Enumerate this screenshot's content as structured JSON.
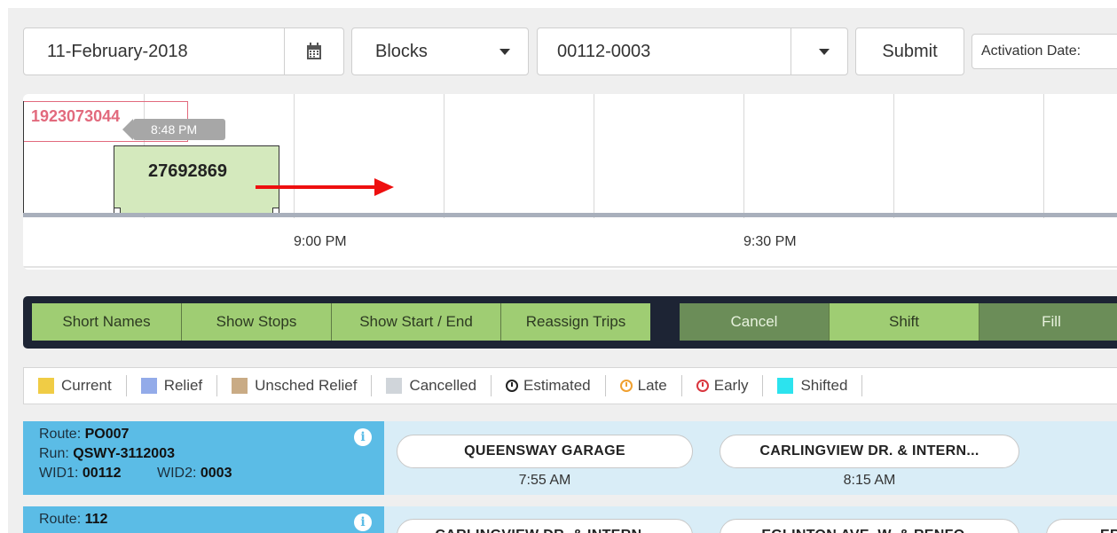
{
  "toolbar": {
    "date_value": "11-February-2018",
    "view_value": "Blocks",
    "vehicle_value": "00112-0003",
    "submit_label": "Submit",
    "activation_label": "Activation Date:"
  },
  "timeline": {
    "block_red_label": "1923073044",
    "block_green_label": "27692869",
    "tooltip_time": "8:48 PM",
    "tick_labels": [
      "9:00 PM",
      "9:30 PM"
    ]
  },
  "actions": {
    "short_names": "Short Names",
    "show_stops": "Show Stops",
    "show_start_end": "Show Start / End",
    "reassign_trips": "Reassign Trips",
    "cancel": "Cancel",
    "shift": "Shift",
    "fill": "Fill"
  },
  "legend": {
    "current": "Current",
    "relief": "Relief",
    "unsched_relief": "Unsched Relief",
    "cancelled": "Cancelled",
    "estimated": "Estimated",
    "late": "Late",
    "early": "Early",
    "shifted": "Shifted"
  },
  "colors": {
    "current": "#f0cc45",
    "relief": "#93abe9",
    "unsched_relief": "#c9ab85",
    "cancelled": "#d0d5da",
    "late": "#f0a030",
    "early": "#d9363e",
    "shifted": "#2ce3ee"
  },
  "rows": [
    {
      "route_label": "Route:",
      "route": "PO007",
      "run_label": "Run:",
      "run": "QSWY-3112003",
      "wid1_label": "WID1:",
      "wid1": "00112",
      "wid2_label": "WID2:",
      "wid2": "0003",
      "stops": [
        {
          "name": "QUEENSWAY GARAGE",
          "time": "7:55 AM"
        },
        {
          "name": "CARLINGVIEW DR. & INTERN...",
          "time": "8:15 AM"
        }
      ]
    },
    {
      "route_label": "Route:",
      "route": "112",
      "stops": [
        {
          "name": "CARLINGVIEW DR. & INTERN..."
        },
        {
          "name": "EGLINTON AVE. W. & RENFO..."
        },
        {
          "name": "ERINGA..."
        }
      ]
    }
  ]
}
